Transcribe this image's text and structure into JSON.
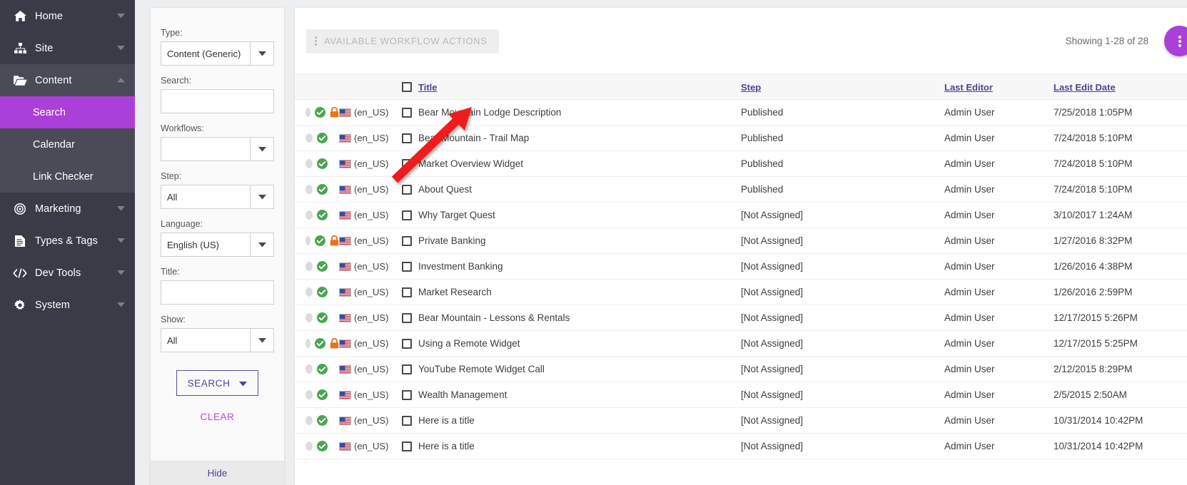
{
  "sidebar": {
    "items": [
      {
        "label": "Home",
        "icon": "home-icon",
        "caret": "chevron-down-icon",
        "expanded": false
      },
      {
        "label": "Site",
        "icon": "sitemap-icon",
        "caret": "chevron-down-icon",
        "expanded": false
      },
      {
        "label": "Content",
        "icon": "folder-open-icon",
        "caret": "chevron-up-icon",
        "expanded": true
      },
      {
        "label": "Marketing",
        "icon": "target-icon",
        "caret": "chevron-down-icon",
        "expanded": false
      },
      {
        "label": "Types & Tags",
        "icon": "document-icon",
        "caret": "chevron-down-icon",
        "expanded": false
      },
      {
        "label": "Dev Tools",
        "icon": "code-icon",
        "caret": "chevron-down-icon",
        "expanded": false
      },
      {
        "label": "System",
        "icon": "gear-icon",
        "caret": "chevron-down-icon",
        "expanded": false
      }
    ],
    "sub_items": [
      {
        "label": "Search",
        "active": true
      },
      {
        "label": "Calendar",
        "active": false
      },
      {
        "label": "Link Checker",
        "active": false
      }
    ],
    "colors": {
      "bg": "#3b3a47",
      "expanded_bg": "#4b4a57",
      "active_bg": "#ab3fd9"
    }
  },
  "filters": {
    "type": {
      "label": "Type:",
      "value": "Content (Generic)"
    },
    "search": {
      "label": "Search:",
      "value": "",
      "placeholder": ""
    },
    "workflows": {
      "label": "Workflows:",
      "value": ""
    },
    "step": {
      "label": "Step:",
      "value": "All"
    },
    "language": {
      "label": "Language:",
      "value": "English (US)"
    },
    "title": {
      "label": "Title:",
      "value": "",
      "placeholder": ""
    },
    "show": {
      "label": "Show:",
      "value": "All"
    },
    "search_button": "SEARCH",
    "clear_link": "CLEAR",
    "hide_link": "Hide"
  },
  "toolbar": {
    "workflow_actions_label": "AVAILABLE WORKFLOW ACTIONS",
    "workflow_actions_icon": "kebab-menu-icon",
    "showing_text": "Showing 1-28 of 28",
    "fab_icon": "kebab-menu-icon",
    "fab_color": "#ab3fd9"
  },
  "table": {
    "columns": [
      {
        "key": "status",
        "label": ""
      },
      {
        "key": "lang",
        "label": ""
      },
      {
        "key": "title",
        "label": "Title",
        "sortable": true
      },
      {
        "key": "step",
        "label": "Step",
        "sortable": true
      },
      {
        "key": "editor",
        "label": "Last Editor",
        "sortable": true
      },
      {
        "key": "date",
        "label": "Last Edit Date",
        "sortable": true
      }
    ],
    "lang_code": "(en_US)",
    "flag_icon": "us-flag-icon",
    "rows": [
      {
        "locked": true,
        "lang": "(en_US)",
        "title": "Bear Mountain Lodge Description",
        "step": "Published",
        "editor": "Admin User",
        "date": "7/25/2018 1:05PM"
      },
      {
        "locked": false,
        "lang": "(en_US)",
        "title": "Bear Mountain - Trail Map",
        "step": "Published",
        "editor": "Admin User",
        "date": "7/24/2018 5:10PM"
      },
      {
        "locked": false,
        "lang": "(en_US)",
        "title": "Market Overview Widget",
        "step": "Published",
        "editor": "Admin User",
        "date": "7/24/2018 5:10PM"
      },
      {
        "locked": false,
        "lang": "(en_US)",
        "title": "About Quest",
        "step": "Published",
        "editor": "Admin User",
        "date": "7/24/2018 5:10PM"
      },
      {
        "locked": false,
        "lang": "(en_US)",
        "title": "Why Target Quest",
        "step": "[Not Assigned]",
        "editor": "Admin User",
        "date": "3/10/2017 1:24AM"
      },
      {
        "locked": true,
        "lang": "(en_US)",
        "title": "Private Banking",
        "step": "[Not Assigned]",
        "editor": "Admin User",
        "date": "1/27/2016 8:32PM"
      },
      {
        "locked": false,
        "lang": "(en_US)",
        "title": "Investment Banking",
        "step": "[Not Assigned]",
        "editor": "Admin User",
        "date": "1/26/2016 4:38PM"
      },
      {
        "locked": false,
        "lang": "(en_US)",
        "title": "Market Research",
        "step": "[Not Assigned]",
        "editor": "Admin User",
        "date": "1/26/2016 2:59PM"
      },
      {
        "locked": false,
        "lang": "(en_US)",
        "title": "Bear Mountain - Lessons & Rentals",
        "step": "[Not Assigned]",
        "editor": "Admin User",
        "date": "12/17/2015 5:26PM"
      },
      {
        "locked": true,
        "lang": "(en_US)",
        "title": "Using a Remote Widget",
        "step": "[Not Assigned]",
        "editor": "Admin User",
        "date": "12/17/2015 5:25PM"
      },
      {
        "locked": false,
        "lang": "(en_US)",
        "title": "YouTube Remote Widget Call",
        "step": "[Not Assigned]",
        "editor": "Admin User",
        "date": "2/12/2015 8:29PM"
      },
      {
        "locked": false,
        "lang": "(en_US)",
        "title": "Wealth Management",
        "step": "[Not Assigned]",
        "editor": "Admin User",
        "date": "2/5/2015 2:50AM"
      },
      {
        "locked": false,
        "lang": "(en_US)",
        "title": "Here is a title",
        "step": "[Not Assigned]",
        "editor": "Admin User",
        "date": "10/31/2014 10:42PM"
      },
      {
        "locked": false,
        "lang": "(en_US)",
        "title": "Here is a title",
        "step": "[Not Assigned]",
        "editor": "Admin User",
        "date": "10/31/2014 10:42PM"
      }
    ]
  },
  "annotation": {
    "type": "arrow",
    "color": "#ee1d1d",
    "points_to": "lock-icon-row-1"
  }
}
